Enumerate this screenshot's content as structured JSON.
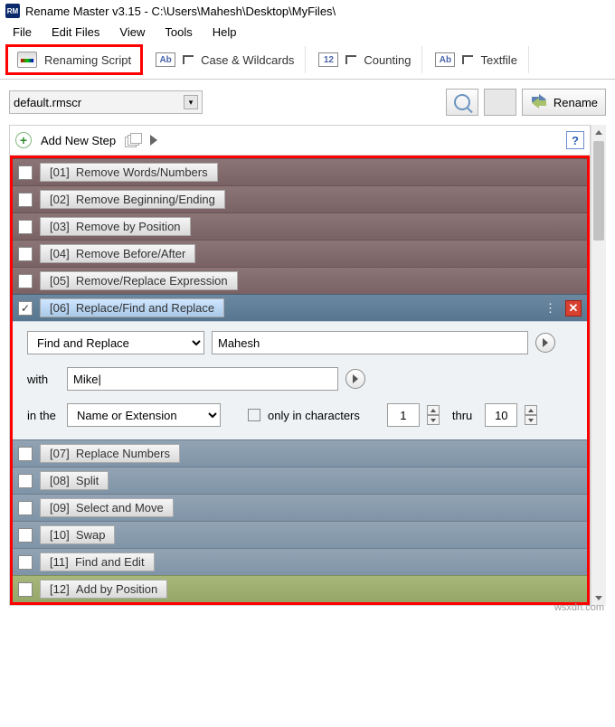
{
  "window": {
    "title": "Rename Master v3.15 - C:\\Users\\Mahesh\\Desktop\\MyFiles\\"
  },
  "menu": {
    "file": "File",
    "edit": "Edit Files",
    "view": "View",
    "tools": "Tools",
    "help": "Help"
  },
  "tabs": {
    "script": "Renaming Script",
    "case": "Case & Wildcards",
    "count": "Counting",
    "text": "Textfile"
  },
  "top": {
    "scriptName": "default.rmscr",
    "renameBtn": "Rename"
  },
  "add": {
    "label": "Add New Step",
    "help": "?"
  },
  "steps": [
    {
      "id": "[01]",
      "name": "Remove Words/Numbers"
    },
    {
      "id": "[02]",
      "name": "Remove Beginning/Ending"
    },
    {
      "id": "[03]",
      "name": "Remove by Position"
    },
    {
      "id": "[04]",
      "name": "Remove Before/After"
    },
    {
      "id": "[05]",
      "name": "Remove/Replace Expression"
    },
    {
      "id": "[06]",
      "name": "Replace/Find and Replace"
    },
    {
      "id": "[07]",
      "name": "Replace Numbers"
    },
    {
      "id": "[08]",
      "name": "Split"
    },
    {
      "id": "[09]",
      "name": "Select and Move"
    },
    {
      "id": "[10]",
      "name": "Swap"
    },
    {
      "id": "[11]",
      "name": "Find and Edit"
    },
    {
      "id": "[12]",
      "name": "Add by Position"
    }
  ],
  "active": {
    "modeOption": "Find and Replace",
    "findValue": "Mahesh",
    "withLabel": "with",
    "withValue": "Mike|",
    "inLabel": "in the",
    "scopeOption": "Name or Extension",
    "onlyChars": "only in characters",
    "fromVal": "1",
    "thru": "thru",
    "toVal": "10"
  },
  "watermark": "wsxdn.com"
}
